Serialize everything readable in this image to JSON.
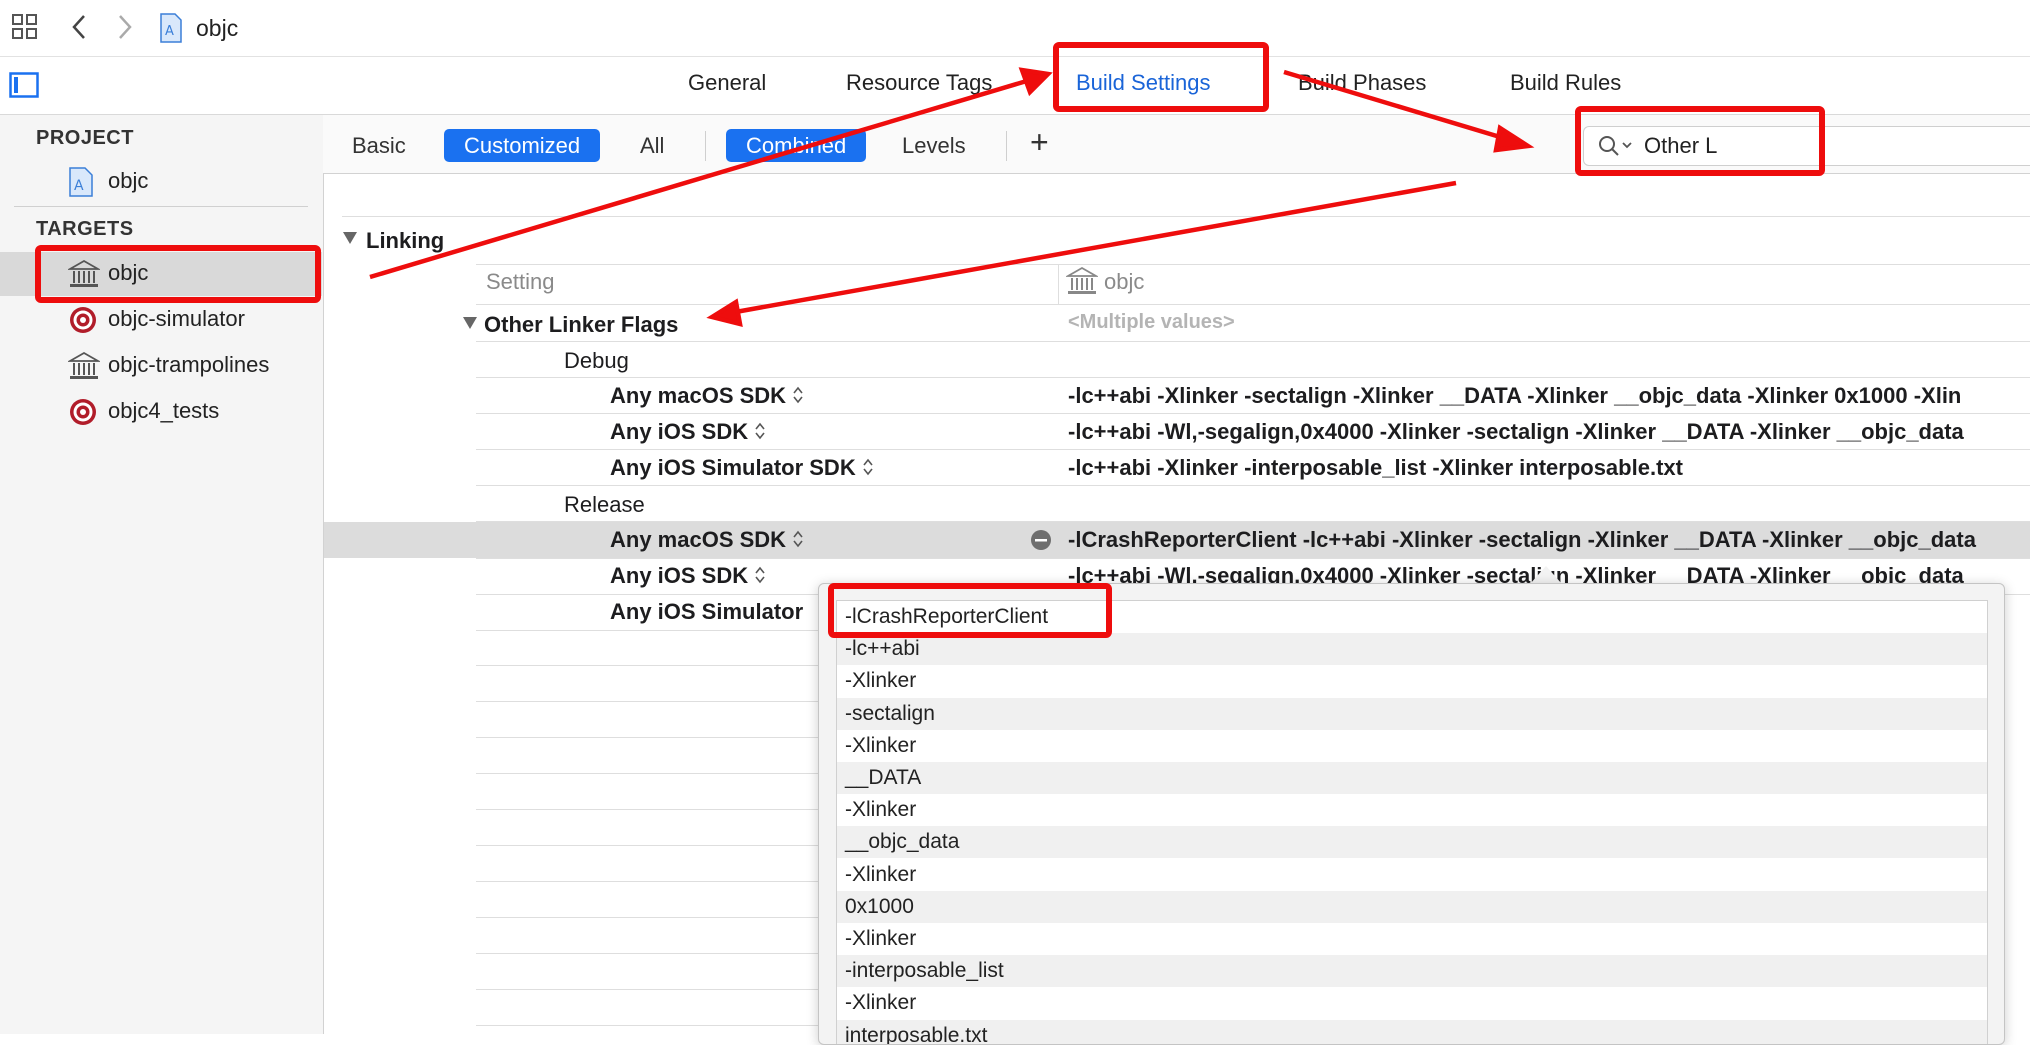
{
  "toolbar": {
    "project_name": "objc"
  },
  "tabs": [
    "General",
    "Resource Tags",
    "Build Settings",
    "Build Phases",
    "Build Rules"
  ],
  "sidebar": {
    "project_header": "PROJECT",
    "project_item": "objc",
    "targets_header": "TARGETS",
    "targets": [
      "objc",
      "objc-simulator",
      "objc-trampolines",
      "objc4_tests"
    ]
  },
  "filter": {
    "basic": "Basic",
    "customized": "Customized",
    "all": "All",
    "combined": "Combined",
    "levels": "Levels",
    "add": "+"
  },
  "search": {
    "value": "Other L"
  },
  "section": {
    "title": "Linking",
    "setting_header": "Setting",
    "target_header": "objc",
    "setting_name": "Other Linker Flags",
    "setting_value": "<Multiple values>",
    "debug_label": "Debug",
    "release_label": "Release",
    "debug_rows": [
      {
        "sdk": "Any macOS SDK",
        "value": "-lc++abi -Xlinker -sectalign -Xlinker __DATA -Xlinker __objc_data -Xlinker 0x1000 -Xlin"
      },
      {
        "sdk": "Any iOS SDK",
        "value": "-lc++abi -Wl,-segalign,0x4000 -Xlinker -sectalign -Xlinker __DATA -Xlinker __objc_data"
      },
      {
        "sdk": "Any iOS Simulator SDK",
        "value": "-lc++abi -Xlinker -interposable_list -Xlinker interposable.txt"
      }
    ],
    "release_rows": [
      {
        "sdk": "Any macOS SDK",
        "value": "-lCrashReporterClient -lc++abi -Xlinker -sectalign -Xlinker __DATA -Xlinker __objc_data"
      },
      {
        "sdk": "Any iOS SDK",
        "value": "-lc++abi -Wl,-segalign,0x4000 -Xlinker -sectalign -Xlinker __DATA -Xlinker __objc_data"
      },
      {
        "sdk": "Any iOS Simulator"
      }
    ]
  },
  "popup_items": [
    "-lCrashReporterClient",
    "-lc++abi",
    "-Xlinker",
    "-sectalign",
    "-Xlinker",
    "__DATA",
    "-Xlinker",
    "__objc_data",
    "-Xlinker",
    "0x1000",
    "-Xlinker",
    "-interposable_list",
    "-Xlinker",
    "interposable.txt"
  ],
  "colors": {
    "accent": "#1a71f0",
    "annotation": "#ee0d0d",
    "selected_row": "#dcdcdc"
  }
}
